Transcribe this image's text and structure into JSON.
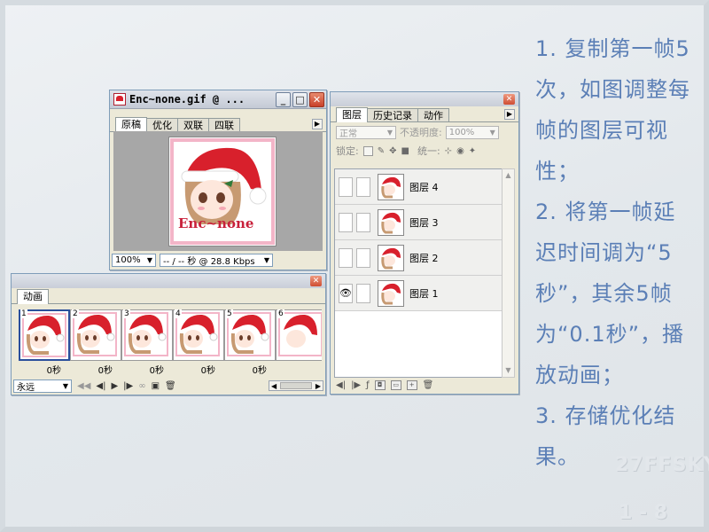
{
  "image_window": {
    "title": "Enc~none.gif @ ...",
    "tabs": [
      "原稿",
      "优化",
      "双联",
      "四联"
    ],
    "zoom": "100%",
    "status": "-- / -- 秒 @ 28.8 Kbps",
    "image_caption": "Enc~none"
  },
  "layers_panel": {
    "tabs": [
      "图层",
      "历史记录",
      "动作"
    ],
    "blend_mode": "正常",
    "opacity_label": "不透明度:",
    "opacity_value": "100%",
    "lock_label": "锁定:",
    "unify_label": "统一:",
    "layers": [
      {
        "name": "图层 4",
        "visible": false
      },
      {
        "name": "图层 3",
        "visible": false
      },
      {
        "name": "图层 2",
        "visible": false
      },
      {
        "name": "图层 1",
        "visible": true
      }
    ]
  },
  "animation_panel": {
    "tab": "动画",
    "frames": [
      {
        "num": "1",
        "delay": "0秒"
      },
      {
        "num": "2",
        "delay": "0秒"
      },
      {
        "num": "3",
        "delay": "0秒"
      },
      {
        "num": "4",
        "delay": "0秒"
      },
      {
        "num": "5",
        "delay": "0秒"
      },
      {
        "num": "6",
        "delay": ""
      }
    ],
    "loop": "永远"
  },
  "instructions": [
    "1. 复制第一帧5次，如图调整每帧的图层可视性；",
    "2. 将第一帧延迟时间调为“5秒”，其余5帧为“0.1秒”，播放动画；",
    "3. 存储优化结果。"
  ],
  "watermark": "27FFSKY",
  "page_number": "1 - 8",
  "colors": {
    "instruction_text": "#5b7fb6",
    "hat_red": "#d8202c",
    "frame_pink": "#f3b5c8",
    "selected_frame": "#2a4f9c"
  }
}
